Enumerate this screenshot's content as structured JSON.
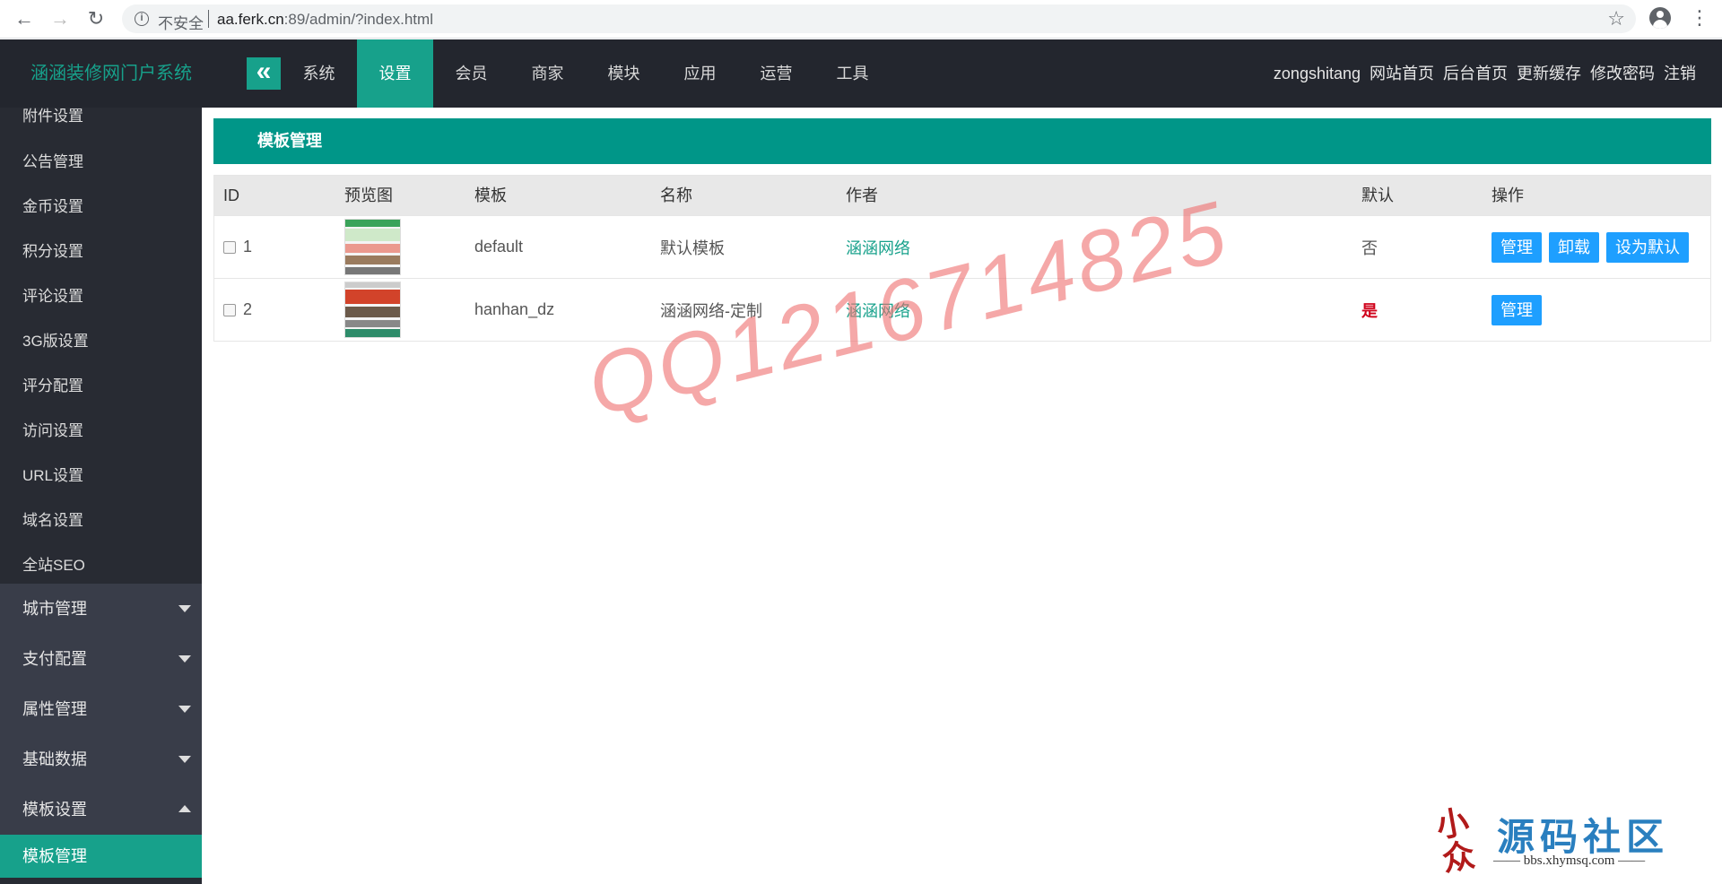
{
  "browser": {
    "insecure_label": "不安全",
    "url_host": "aa.ferk.cn",
    "url_rest": ":89/admin/?index.html"
  },
  "header": {
    "brand": "涵涵装修网门户系统",
    "nav": [
      "系统",
      "设置",
      "会员",
      "商家",
      "模块",
      "应用",
      "运营",
      "工具"
    ],
    "active_nav": "设置",
    "user_links": [
      "zongshitang",
      "网站首页",
      "后台首页",
      "更新缓存",
      "修改密码",
      "注销"
    ]
  },
  "sidebar": {
    "sub_items": [
      "附件设置",
      "公告管理",
      "金币设置",
      "积分设置",
      "评论设置",
      "3G版设置",
      "评分配置",
      "访问设置",
      "URL设置",
      "域名设置",
      "全站SEO"
    ],
    "groups": [
      {
        "label": "城市管理",
        "expanded": false
      },
      {
        "label": "支付配置",
        "expanded": false
      },
      {
        "label": "属性管理",
        "expanded": false
      },
      {
        "label": "基础数据",
        "expanded": false
      },
      {
        "label": "模板设置",
        "expanded": true
      }
    ],
    "active_item": "模板管理"
  },
  "main": {
    "title": "模板管理",
    "columns": [
      "ID",
      "预览图",
      "模板",
      "名称",
      "作者",
      "默认",
      "操作"
    ],
    "rows": [
      {
        "id": "1",
        "template": "default",
        "name": "默认模板",
        "author": "涵涵网络",
        "default": "否",
        "actions": [
          "管理",
          "卸载",
          "设为默认"
        ]
      },
      {
        "id": "2",
        "template": "hanhan_dz",
        "name": "涵涵网络-定制",
        "author": "涵涵网络",
        "default": "是",
        "actions": [
          "管理"
        ]
      }
    ]
  },
  "overlay": {
    "watermark": "QQ1216714825",
    "logo_name": "源码社区",
    "logo_mark": "小众",
    "logo_url": "—— bbs.xhymsq.com ——"
  },
  "colors": {
    "accent": "#17a18b",
    "panel_title": "#009688",
    "button": "#1e9fff",
    "header_bg": "#23262e",
    "sidebar_bg": "#282b33"
  }
}
